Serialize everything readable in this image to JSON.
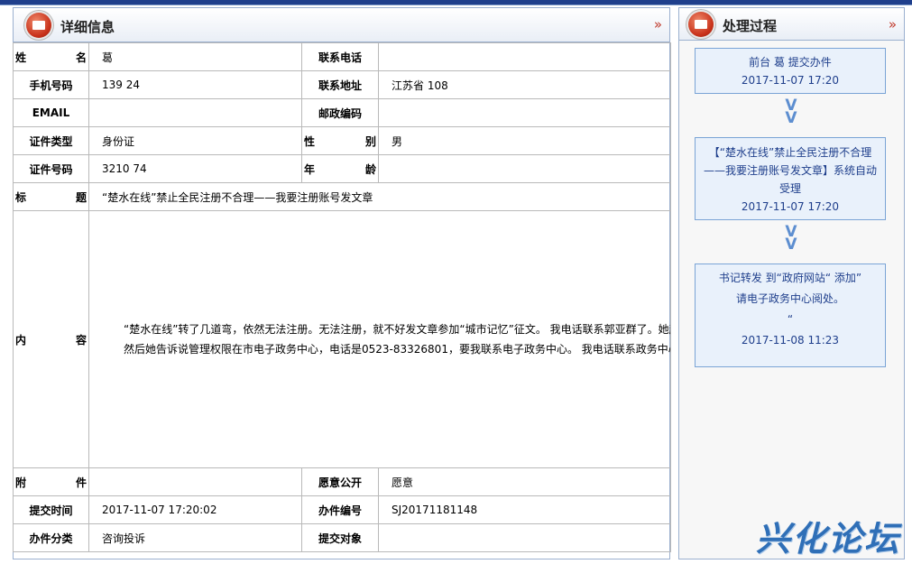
{
  "left_panel": {
    "title": "详细信息",
    "arrows": "»",
    "fields": {
      "name_label": [
        "姓",
        "名"
      ],
      "name_value": "葛",
      "phone_label": "联系电话",
      "phone_value": "",
      "mobile_label": "手机号码",
      "mobile_value": "139        24",
      "address_label": "联系地址",
      "address_value": "江苏省                              108",
      "email_label": "EMAIL",
      "email_value": "",
      "zip_label": "邮政编码",
      "zip_value": "",
      "idtype_label": "证件类型",
      "idtype_value": "身份证",
      "gender_label": [
        "性",
        "别"
      ],
      "gender_value": "男",
      "idnum_label": "证件号码",
      "idnum_value": "3210              74",
      "age_label": [
        "年",
        "龄"
      ],
      "age_value": "",
      "subject_label": [
        "标",
        "题"
      ],
      "subject_value": "“楚水在线”禁止全民注册不合理——我要注册账号发文章",
      "content_label": [
        "内",
        "容"
      ],
      "content_paragraphs": [
        "“楚水在线”转了几道弯，依然无法注册。无法注册，就不好发文章参加“城市记忆”征文。        我电话联系郭亚群了。她起初叫我用手机给他发个信息，她给我邀请码注册。后来电话回我现在没有邀请码了。        然后说可以手机验证码注册。我说根本就没有地方可以写字，哪有手机验证码注册？她自己去试探了一下，确实是无法注册。",
        "然后她告诉说管理权限在市电子政务中心，电话是0523-83326801，要我联系电子政务中心。        我电话联系政务中心。一个女工作人员接的。她也是说手机验证，微信验证注册。我说根本不可以注册，没有填写的对话框，怎么注册？她又说现在实名认证了，所以不好注册。        我说我注册湖北日报的网站时，人家也是邀请码，或者手机短信验证。我没有邀请码，只好用手机短信验证，然后输入身份证号码，真实姓名，就直接注册了呀!        现在你这论坛禁止别人写字，怎么注册？你没有任何注册的窗口。        她说这个需要问技术人员的，只能这样了。        这就是到目前为止，“楚水在线”注册的情况。结果是找任何人都无法注册。        国家要求网络发言实名认证，不是要求禁止全民网络发言，而是要求每个人负责任地发言。        发文章也一样啊。谁的文章谁负责。你网站有管理责任。即使别人发的文章你感觉不合适，你不是还有审核这一关么？你觉得合适，你就放行；你觉得不合适，你就不放行。这不是很简单的事情么？        2017年11月7日"
      ],
      "attach_label": [
        "附",
        "件"
      ],
      "attach_value": "",
      "public_label": "愿意公开",
      "public_value": "愿意",
      "submit_time_label": "提交时间",
      "submit_time_value": "2017-11-07 17:20:02",
      "case_no_label": "办件编号",
      "case_no_value": "SJ20171181148",
      "category_label": "办件分类",
      "category_value": "咨询投诉",
      "target_label": "提交对象",
      "target_value": ""
    }
  },
  "right_panel": {
    "title": "处理过程",
    "arrows": "»",
    "steps": [
      {
        "line1": "前台  葛          提交办件",
        "time": "2017-11-07 17:20"
      },
      {
        "line1": "【“楚水在线”禁止全民注册不合理——我要注册账号发文章】系统自动受理",
        "time": "2017-11-07 17:20"
      },
      {
        "line1": "书记转发 到“政府网站“ 添加”",
        "line2": "请电子政务中心阅处。",
        "line3": "“",
        "time": "2017-11-08 11:23"
      }
    ],
    "arrow_glyph": "V"
  },
  "watermark": "兴化论坛",
  "colors": {
    "accent": "#1f3f8c",
    "box_border": "#7aa4d6",
    "box_bg": "#e9f1fb",
    "icon_red": "#c8311a"
  }
}
